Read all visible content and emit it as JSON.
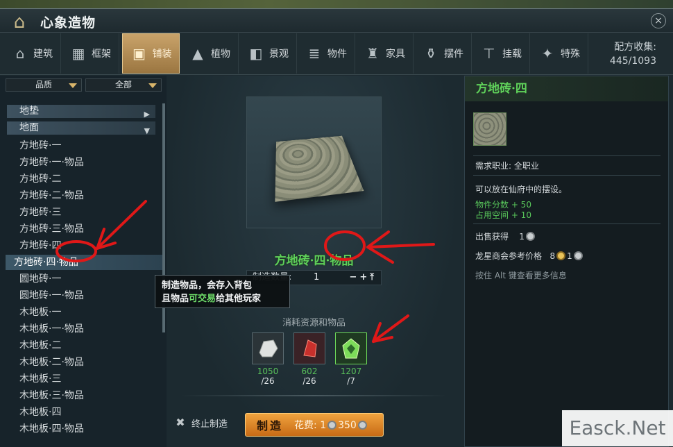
{
  "window": {
    "title": "心象造物",
    "close_label": "×"
  },
  "tabs": [
    {
      "label": "建筑",
      "icon": "house-icon"
    },
    {
      "label": "框架",
      "icon": "frame-icon"
    },
    {
      "label": "铺装",
      "icon": "paving-icon",
      "active": true
    },
    {
      "label": "植物",
      "icon": "tree-icon"
    },
    {
      "label": "景观",
      "icon": "landscape-icon"
    },
    {
      "label": "物件",
      "icon": "stack-icon"
    },
    {
      "label": "家具",
      "icon": "chair-icon"
    },
    {
      "label": "摆件",
      "icon": "vase-icon"
    },
    {
      "label": "挂载",
      "icon": "hanger-icon"
    },
    {
      "label": "特殊",
      "icon": "sparkle-icon"
    }
  ],
  "collection": {
    "label": "配方收集:",
    "value": "445/1093"
  },
  "filters": {
    "quality": "品质",
    "all": "全部"
  },
  "categories": [
    {
      "label": "地垫",
      "state": "▶"
    },
    {
      "label": "地面",
      "state": "▼"
    }
  ],
  "recipe_list": [
    "方地砖·一",
    "方地砖·一·物品",
    "方地砖·二",
    "方地砖·二·物品",
    "方地砖·三",
    "方地砖·三·物品",
    "方地砖·四",
    "方地砖·四·物品",
    "圆地砖·一",
    "圆地砖·一·物品",
    "木地板·一",
    "木地板·一·物品",
    "木地板·二",
    "木地板·二·物品",
    "木地板·三",
    "木地板·三·物品",
    "木地板·四",
    "木地板·四·物品"
  ],
  "selected_index": 7,
  "tooltip": {
    "line1": "制造物品，会存入背包",
    "line2_a": "且物品",
    "line2_hl": "可交易",
    "line2_b": "给其他玩家"
  },
  "center": {
    "item_name": "方地砖·四·物品",
    "qty_label": "制造数量:",
    "qty_value": "1",
    "qty_buttons": "−+⤒",
    "materials_title": "消耗资源和物品",
    "materials": [
      {
        "icon": "stone-icon",
        "have": "1050",
        "need": "/26"
      },
      {
        "icon": "red-crystal-icon",
        "have": "602",
        "need": "/26"
      },
      {
        "icon": "green-emblem-icon",
        "have": "1207",
        "need": "/7"
      }
    ],
    "stop_label": "终止制造",
    "make_label": "制造",
    "cost_label": "花费:",
    "cost_a": "1",
    "cost_b": "350"
  },
  "detail": {
    "title": "方地砖·四",
    "job": "需求职业: 全职业",
    "desc": "可以放在仙府中的摆设。",
    "score": "物件分数 + 50",
    "space": "占用空间 + 10",
    "sell_label": "出售获得",
    "sell_value": "1",
    "ref_label": "龙星商会参考价格",
    "ref_gold": "8",
    "ref_silver": "1",
    "hint": "按住 Alt 键查看更多信息"
  },
  "watermark": "Easck.Net",
  "colors": {
    "accent_green": "#5fd15a",
    "active_tab": "#c9a36a",
    "arrow_red": "#e01818",
    "button_orange": "#f0a33e"
  }
}
